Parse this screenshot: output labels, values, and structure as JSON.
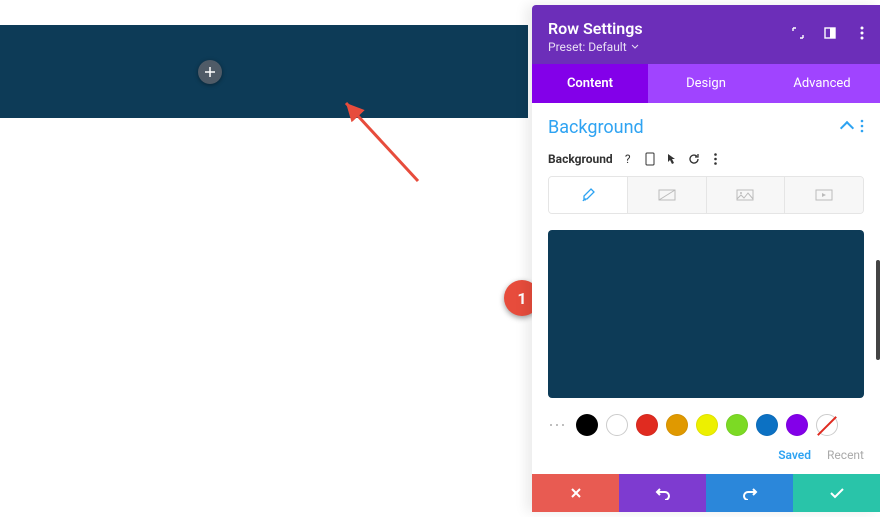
{
  "accent": "#2ea3f2",
  "canvas": {
    "band_color": "#0d3b57"
  },
  "panel": {
    "title": "Row Settings",
    "preset_label": "Preset: Default",
    "tabs": [
      {
        "label": "Content",
        "active": true
      },
      {
        "label": "Design",
        "active": false
      },
      {
        "label": "Advanced",
        "active": false
      }
    ],
    "section_title": "Background",
    "bg_label": "Background",
    "help_icons": [
      "help",
      "phone",
      "cursor",
      "reset",
      "more"
    ],
    "bg_type_tabs": [
      "color",
      "gradient",
      "image",
      "video"
    ],
    "preview_color": "#0d3b57",
    "swatches": [
      {
        "name": "black",
        "hex": "#000000"
      },
      {
        "name": "white",
        "hex": "#ffffff"
      },
      {
        "name": "red",
        "hex": "#e02b20"
      },
      {
        "name": "orange",
        "hex": "#e09900"
      },
      {
        "name": "yellow",
        "hex": "#edf000"
      },
      {
        "name": "green",
        "hex": "#7cda24"
      },
      {
        "name": "blue",
        "hex": "#0c71c3"
      },
      {
        "name": "purple",
        "hex": "#8300e9"
      },
      {
        "name": "none",
        "hex": "transparent"
      }
    ],
    "saved_label": "Saved",
    "recent_label": "Recent",
    "footer": {
      "cancel": "Cancel",
      "undo": "Undo",
      "redo": "Redo",
      "save": "Save"
    }
  },
  "annotation": {
    "number": "1"
  }
}
